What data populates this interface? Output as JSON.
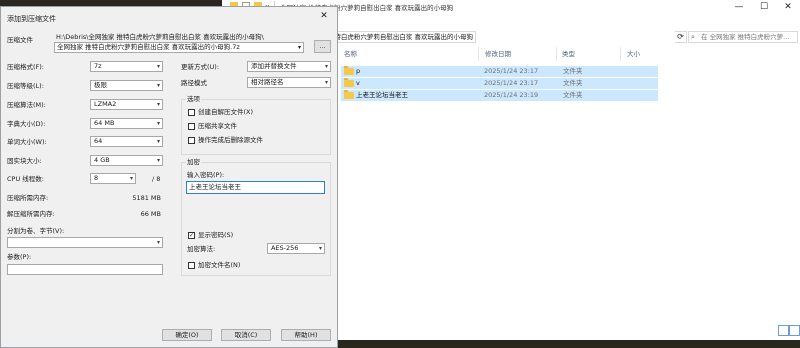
{
  "explorer": {
    "window_title": "全网独家 推特白虎粉穴萝莉自慰出白浆 喜欢玩露出的小母狗",
    "address_path": "OSHIBA EXT (H:)  ›  Debris  ›  全网独家 推特白虎粉穴萝莉自慰出白浆 喜欢玩露出的小母狗",
    "search_placeholder": "在 全网独家 推特白虎粉穴萝...",
    "columns": {
      "name": "名称",
      "date": "修改日期",
      "type": "类型",
      "size": "大小"
    },
    "files": [
      {
        "name": "p",
        "date": "2025/1/24 23:17",
        "type": "文件夹"
      },
      {
        "name": "v",
        "date": "2025/1/24 23:17",
        "type": "文件夹"
      },
      {
        "name": "上老王论坛当老王",
        "date": "2025/1/24 23:19",
        "type": "文件夹"
      }
    ],
    "folder_color": "#f5c84c",
    "selection_color": "#cce8ff"
  },
  "dialog": {
    "title": "添加到压缩文件",
    "archive_label": "压缩文件",
    "archive_dir": "H:\\Debris\\全网独家 推特白虎粉穴萝莉自慰出白浆 喜欢玩露出的小母狗\\",
    "archive_name": "全网独家 推特白虎粉穴萝莉自慰出白浆 喜欢玩露出的小母狗.7z",
    "browse_label": "...",
    "left": {
      "format_label": "压缩格式(F):",
      "format_value": "7z",
      "level_label": "压缩等级(L):",
      "level_value": "极限",
      "method_label": "压缩算法(M):",
      "method_value": "LZMA2",
      "dict_label": "字典大小(D):",
      "dict_value": "64 MB",
      "word_label": "单词大小(W):",
      "word_value": "64",
      "solid_label": "固实块大小:",
      "solid_value": "4 GB",
      "threads_label": "CPU 线程数:",
      "threads_value": "8",
      "threads_total": "/ 8",
      "mem_compress_label": "压缩所需内存:",
      "mem_compress_value": "5181 MB",
      "mem_decompress_label": "解压缩所需内存:",
      "mem_decompress_value": "66 MB",
      "split_label": "分割为卷、字节(V):",
      "params_label": "参数(P):"
    },
    "right": {
      "update_label": "更新方式(U):",
      "update_value": "添加并替换文件",
      "path_label": "路径模式",
      "path_value": "相对路径名",
      "options_title": "选项",
      "opt_sfx": "创建自解压文件(X)",
      "opt_shared": "压缩共享文件",
      "opt_delete": "操作完成后删除源文件",
      "encryption_title": "加密",
      "password_label": "输入密码(P):",
      "password_value": "上老王论坛当老王",
      "show_password": "显示密码(S)",
      "show_password_checked": true,
      "enc_method_label": "加密算法:",
      "enc_method_value": "AES-256",
      "encrypt_names": "加密文件名(N)"
    },
    "buttons": {
      "ok": "确定(O)",
      "cancel": "取消(C)",
      "help": "帮助(H)"
    }
  },
  "icons": {
    "checkmark": "✓",
    "dropdown": "▾",
    "close": "✕",
    "minimize": "—",
    "maximize": "☐",
    "search": "⌕",
    "refresh": "⟳",
    "chevron-down": "⌄"
  }
}
